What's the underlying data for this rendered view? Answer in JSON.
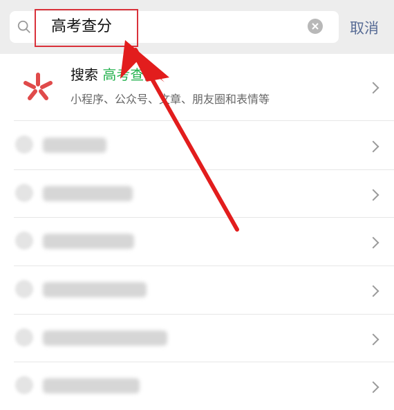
{
  "search": {
    "query": "高考查分",
    "cancel_label": "取消"
  },
  "suggestion": {
    "prefix": "搜索",
    "keyword": "高考查分",
    "subtitle": "小程序、公众号、文章、朋友圈和表情等",
    "icon": "search-brand-icon"
  },
  "blurred_results": {
    "count_visible": 6,
    "note": "blurred suggestion rows"
  },
  "colors": {
    "accent": "#22b14c",
    "link": "#576b95",
    "annotation": "#d9313a"
  }
}
